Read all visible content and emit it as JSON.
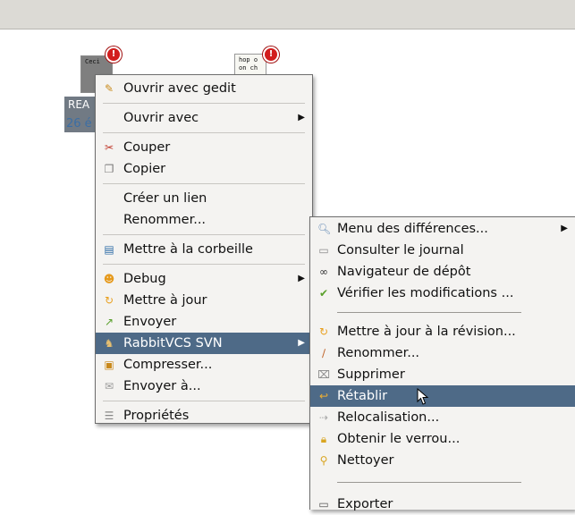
{
  "desktop": {
    "file1_text": "Ceci",
    "file2_text_line1": "hop o",
    "file2_text_line2": "on ch",
    "emblem_symbol": "!",
    "caption_line1": "REA",
    "caption_line2": "26 é"
  },
  "context_menu": {
    "items": [
      {
        "label": "Ouvrir avec gedit",
        "icon": "gedit-icon"
      },
      {
        "label": "Ouvrir avec",
        "icon": ""
      },
      {
        "label": "Couper",
        "icon": "scissors-icon"
      },
      {
        "label": "Copier",
        "icon": "copy-icon"
      },
      {
        "label": "Créer un lien",
        "icon": ""
      },
      {
        "label": "Renommer...",
        "icon": ""
      },
      {
        "label": "Mettre à la corbeille",
        "icon": "trash-icon"
      },
      {
        "label": "Debug",
        "icon": "debug-icon"
      },
      {
        "label": "Mettre à jour",
        "icon": "update-icon"
      },
      {
        "label": "Envoyer",
        "icon": "commit-icon"
      },
      {
        "label": "RabbitVCS SVN",
        "icon": "rabbit-icon"
      },
      {
        "label": "Compresser...",
        "icon": "archive-icon"
      },
      {
        "label": "Envoyer à...",
        "icon": "send-to-icon"
      },
      {
        "label": "Propriétés",
        "icon": "properties-icon"
      }
    ],
    "highlighted": "RabbitVCS SVN",
    "highlight_color": "#4e6a87"
  },
  "submenu": {
    "items": [
      {
        "label": "Menu des différences...",
        "icon": "diff-icon"
      },
      {
        "label": "Consulter le journal",
        "icon": "log-icon"
      },
      {
        "label": "Navigateur de dépôt",
        "icon": "binoculars-icon"
      },
      {
        "label": "Vérifier les modifications ...",
        "icon": "check-icon"
      },
      {
        "label": "Mettre à jour à la révision...",
        "icon": "update-revision-icon"
      },
      {
        "label": "Renommer...",
        "icon": "rename-icon"
      },
      {
        "label": "Supprimer",
        "icon": "delete-icon"
      },
      {
        "label": "Rétablir",
        "icon": "revert-icon"
      },
      {
        "label": "Relocalisation...",
        "icon": "relocate-icon"
      },
      {
        "label": "Obtenir le verrou...",
        "icon": "lock-icon"
      },
      {
        "label": "Nettoyer",
        "icon": "broom-icon"
      },
      {
        "label": "Exporter",
        "icon": "export-icon"
      }
    ],
    "highlighted": "Rétablir"
  }
}
